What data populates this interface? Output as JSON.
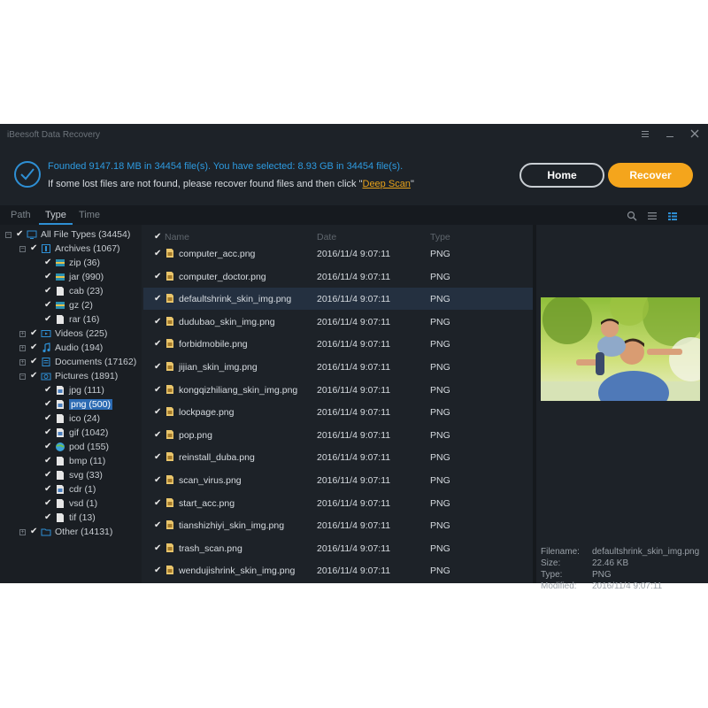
{
  "app": {
    "title": "iBeesoft Data Recovery"
  },
  "window_controls": [
    "menu-icon",
    "minimize-icon",
    "close-icon"
  ],
  "header": {
    "found_text": "Founded 9147.18 MB in 34454 file(s).   You have selected: 8.93 GB in 34454 file(s).",
    "hint_prefix": "If some lost files are not found, please recover found files and then click \"",
    "hint_link": "Deep Scan",
    "hint_suffix": "\"",
    "home_label": "Home",
    "recover_label": "Recover"
  },
  "tabs": [
    {
      "label": "Path"
    },
    {
      "label": "Type"
    },
    {
      "label": "Time"
    }
  ],
  "active_tab": "Type",
  "tree": [
    {
      "label": "All File Types (34454)",
      "icon": "monitor-icon"
    },
    {
      "label": "Archives (1067)",
      "icon": "archive-icon"
    },
    {
      "label": "zip (36)",
      "icon": "zip-icon"
    },
    {
      "label": "jar (990)",
      "icon": "zip-icon"
    },
    {
      "label": "cab (23)",
      "icon": "file-icon"
    },
    {
      "label": "gz (2)",
      "icon": "zip-icon"
    },
    {
      "label": "rar (16)",
      "icon": "file-icon"
    },
    {
      "label": "Videos (225)",
      "icon": "video-icon"
    },
    {
      "label": "Audio (194)",
      "icon": "music-icon"
    },
    {
      "label": "Documents (17162)",
      "icon": "document-icon"
    },
    {
      "label": "Pictures (1891)",
      "icon": "camera-icon"
    },
    {
      "label": "jpg (111)",
      "icon": "image-file-icon"
    },
    {
      "label": "png (500)",
      "icon": "image-file-icon"
    },
    {
      "label": "ico (24)",
      "icon": "file-icon"
    },
    {
      "label": "gif (1042)",
      "icon": "image-file-icon"
    },
    {
      "label": "pod (155)",
      "icon": "globe-icon"
    },
    {
      "label": "bmp (11)",
      "icon": "file-icon"
    },
    {
      "label": "svg (33)",
      "icon": "file-icon"
    },
    {
      "label": "cdr (1)",
      "icon": "image-file-icon"
    },
    {
      "label": "vsd (1)",
      "icon": "file-icon"
    },
    {
      "label": "tif (13)",
      "icon": "file-icon"
    },
    {
      "label": "Other (14131)",
      "icon": "folder-icon"
    }
  ],
  "columns": {
    "name": "Name",
    "date": "Date",
    "type": "Type"
  },
  "files": [
    {
      "name": "computer_acc.png",
      "date": "2016/11/4 9:07:11",
      "type": "PNG"
    },
    {
      "name": "computer_doctor.png",
      "date": "2016/11/4 9:07:11",
      "type": "PNG"
    },
    {
      "name": "defaultshrink_skin_img.png",
      "date": "2016/11/4 9:07:11",
      "type": "PNG"
    },
    {
      "name": "dudubao_skin_img.png",
      "date": "2016/11/4 9:07:11",
      "type": "PNG"
    },
    {
      "name": "forbidmobile.png",
      "date": "2016/11/4 9:07:11",
      "type": "PNG"
    },
    {
      "name": "jijian_skin_img.png",
      "date": "2016/11/4 9:07:11",
      "type": "PNG"
    },
    {
      "name": "kongqizhiliang_skin_img.png",
      "date": "2016/11/4 9:07:11",
      "type": "PNG"
    },
    {
      "name": "lockpage.png",
      "date": "2016/11/4 9:07:11",
      "type": "PNG"
    },
    {
      "name": "pop.png",
      "date": "2016/11/4 9:07:11",
      "type": "PNG"
    },
    {
      "name": "reinstall_duba.png",
      "date": "2016/11/4 9:07:11",
      "type": "PNG"
    },
    {
      "name": "scan_virus.png",
      "date": "2016/11/4 9:07:11",
      "type": "PNG"
    },
    {
      "name": "start_acc.png",
      "date": "2016/11/4 9:07:11",
      "type": "PNG"
    },
    {
      "name": "tianshizhiyi_skin_img.png",
      "date": "2016/11/4 9:07:11",
      "type": "PNG"
    },
    {
      "name": "trash_scan.png",
      "date": "2016/11/4 9:07:11",
      "type": "PNG"
    },
    {
      "name": "wendujishrink_skin_img.png",
      "date": "2016/11/4 9:07:11",
      "type": "PNG"
    }
  ],
  "preview": {
    "filename_label": "Filename:",
    "filename": "defaultshrink_skin_img.png",
    "size_label": "Size:",
    "size": "22.46 KB",
    "type_label": "Type:",
    "type": "PNG",
    "modified_label": "Modified:",
    "modified": "2016/11/4 9:07:11"
  },
  "colors": {
    "accent_blue": "#2e8fd4",
    "recover_orange": "#f4a51c",
    "background": "#1d2228"
  }
}
